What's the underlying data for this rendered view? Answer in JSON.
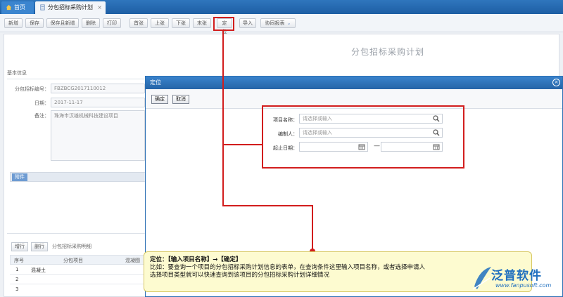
{
  "tabs": {
    "home": "首页",
    "plan": "分包招标采购计划",
    "close": "×"
  },
  "toolbar": {
    "add": "新增",
    "save": "保存",
    "save_new": "保存且新增",
    "delete": "删除",
    "print": "打印",
    "first": "首张",
    "prev": "上张",
    "next": "下张",
    "last": "末张",
    "locate": "定位",
    "import": "导入",
    "collab": "协同报表"
  },
  "form": {
    "title": "分包招标采购计划",
    "section_basic": "基本信息",
    "code_label": "分包招标编号：",
    "code_value": "FBZBCG2017110012",
    "date_label": "日期：",
    "date_value": "2017-11-17",
    "note_label": "备注：",
    "note_value": "珠海市汉雄机械科技建设项目",
    "attach_label": "附件"
  },
  "grid": {
    "add_row": "增行",
    "del_row": "删行",
    "title": "分包招标采购明细",
    "col_no": "序号",
    "col_item": "分包项目",
    "col_extra": "混凝图",
    "rows": [
      {
        "no": "1",
        "item": "混凝土"
      },
      {
        "no": "2",
        "item": ""
      },
      {
        "no": "3",
        "item": ""
      }
    ]
  },
  "dialog": {
    "title": "定位",
    "close": "×",
    "ok": "确定",
    "cancel": "取消",
    "project_label": "项目名称：",
    "project_placeholder": "请选择或输入",
    "author_label": "编制人：",
    "author_placeholder": "请选择或输入",
    "date_label": "起止日期：",
    "date_sep": "—"
  },
  "callout": {
    "line1": "定位：【输入项目名称】→【确定】",
    "line2": "比如：要查询一个项目的分包招标采购计划信息的表单，在查询条件这里输入项目名称，或者选择申请人",
    "line3": "选择项目类型就可以快速查询到该项目的分包招标采购计划详细情况"
  },
  "watermark": {
    "brand": "泛普软件",
    "url": "www.fanpusoft.com"
  },
  "colors": {
    "accent": "#1d5ea4",
    "annotation": "#d21d1d",
    "callout_bg": "#fdfbd0"
  }
}
